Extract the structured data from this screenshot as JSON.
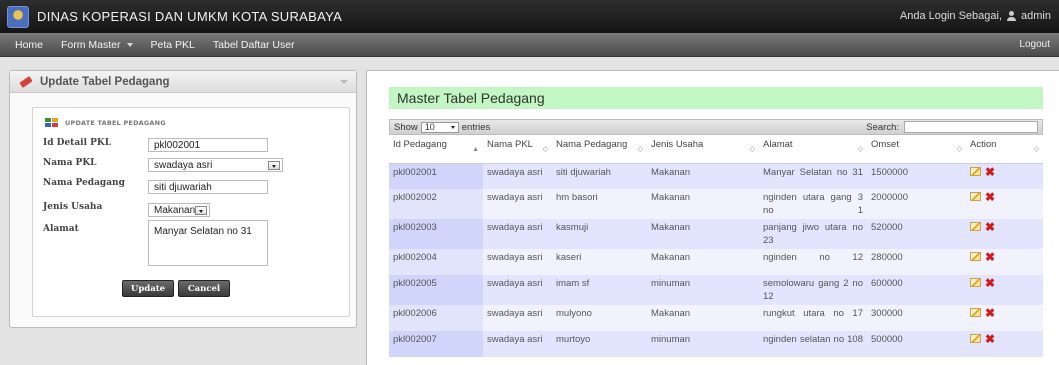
{
  "app": {
    "title": "DINAS KOPERASI DAN UMKM KOTA SURABAYA",
    "login_text": "Anda Login Sebagai,",
    "user": "admin"
  },
  "nav": {
    "items": [
      "Home",
      "Form Master",
      "Peta PKL",
      "Tabel Daftar User"
    ],
    "logout": "Logout"
  },
  "form": {
    "panel_title": "Update Tabel Pedagang",
    "box_title": "UPDATE TABEL PEDAGANG",
    "fields": {
      "id_detail_label": "Id Detail PKL",
      "id_detail_value": "pkl002001",
      "nama_pkl_label": "Nama PKL",
      "nama_pkl_value": "swadaya asri",
      "nama_pedagang_label": "Nama Pedagang",
      "nama_pedagang_value": "siti djuwariah",
      "jenis_usaha_label": "Jenis Usaha",
      "jenis_usaha_value": "Makanan",
      "alamat_label": "Alamat",
      "alamat_value": "Manyar Selatan no 31"
    },
    "update_label": "Update",
    "cancel_label": "Cancel"
  },
  "table": {
    "title": "Master Tabel Pedagang",
    "show_label": "Show",
    "entries_value": "10",
    "entries_label": "entries",
    "search_label": "Search:",
    "columns": [
      "Id Pedagang",
      "Nama PKL",
      "Nama Pedagang",
      "Jenis Usaha",
      "Alamat",
      "Omset",
      "Action"
    ],
    "rows": [
      [
        "pkl002001",
        "swadaya asri",
        "siti djuwariah",
        "Makanan",
        "Manyar Selatan no 31",
        "1500000"
      ],
      [
        "pkl002002",
        "swadaya asri",
        "hm basori",
        "Makanan",
        "nginden utara gang 3 no 1",
        "2000000"
      ],
      [
        "pkl002003",
        "swadaya asri",
        "kasmuji",
        "Makanan",
        "panjang jiwo utara no 23",
        "520000"
      ],
      [
        "pkl002004",
        "swadaya asri",
        "kaseri",
        "Makanan",
        "nginden no 12",
        "280000"
      ],
      [
        "pkl002005",
        "swadaya asri",
        "imam sf",
        "minuman",
        "semolowaru gang 2 no 12",
        "600000"
      ],
      [
        "pkl002006",
        "swadaya asri",
        "mulyono",
        "Makanan",
        "rungkut utara no 17",
        "300000"
      ],
      [
        "pkl002007",
        "swadaya asri",
        "murtoyo",
        "minuman",
        "nginden selatan no 108",
        "500000"
      ]
    ]
  }
}
